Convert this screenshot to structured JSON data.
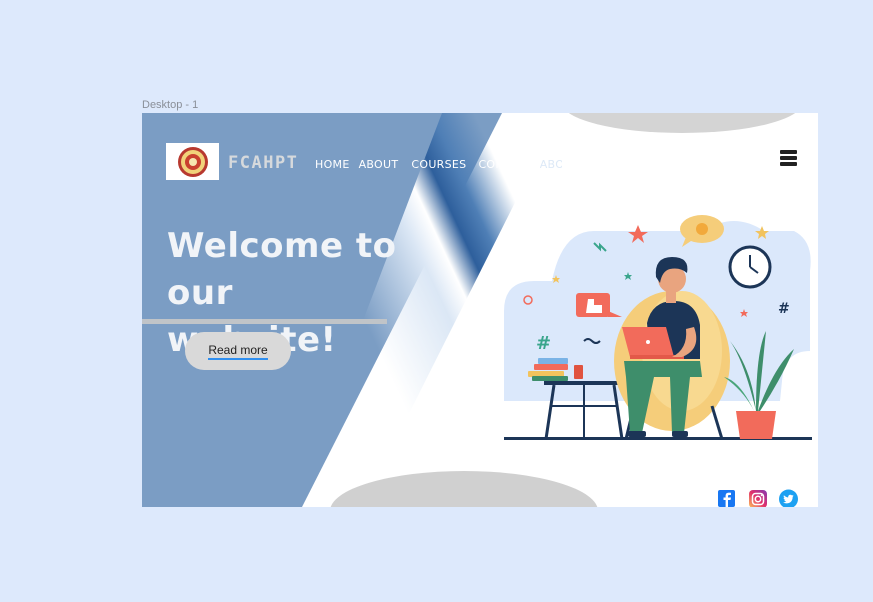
{
  "frame": {
    "label": "Desktop - 1"
  },
  "header": {
    "brand": "FCAHPT",
    "nav": {
      "home": "HOME",
      "about": "ABOUT",
      "courses": "COURSES",
      "contact": "CONTACT",
      "extra": "ABO"
    },
    "menu_icon": "hamburger-icon"
  },
  "hero": {
    "headline_line1": "Welcome to our",
    "headline_line2": "website!",
    "cta_label": "Read more"
  },
  "social": {
    "icons": [
      "facebook-icon",
      "instagram-icon",
      "twitter-icon"
    ]
  },
  "colors": {
    "page_bg": "#dde9fc",
    "hero_panel": "#7b9dc4",
    "accent_blue": "#2e5f9c",
    "button_bg": "#d9d9d9",
    "coral": "#f26b5b",
    "green": "#3e8e6b",
    "navy": "#1c3557"
  }
}
